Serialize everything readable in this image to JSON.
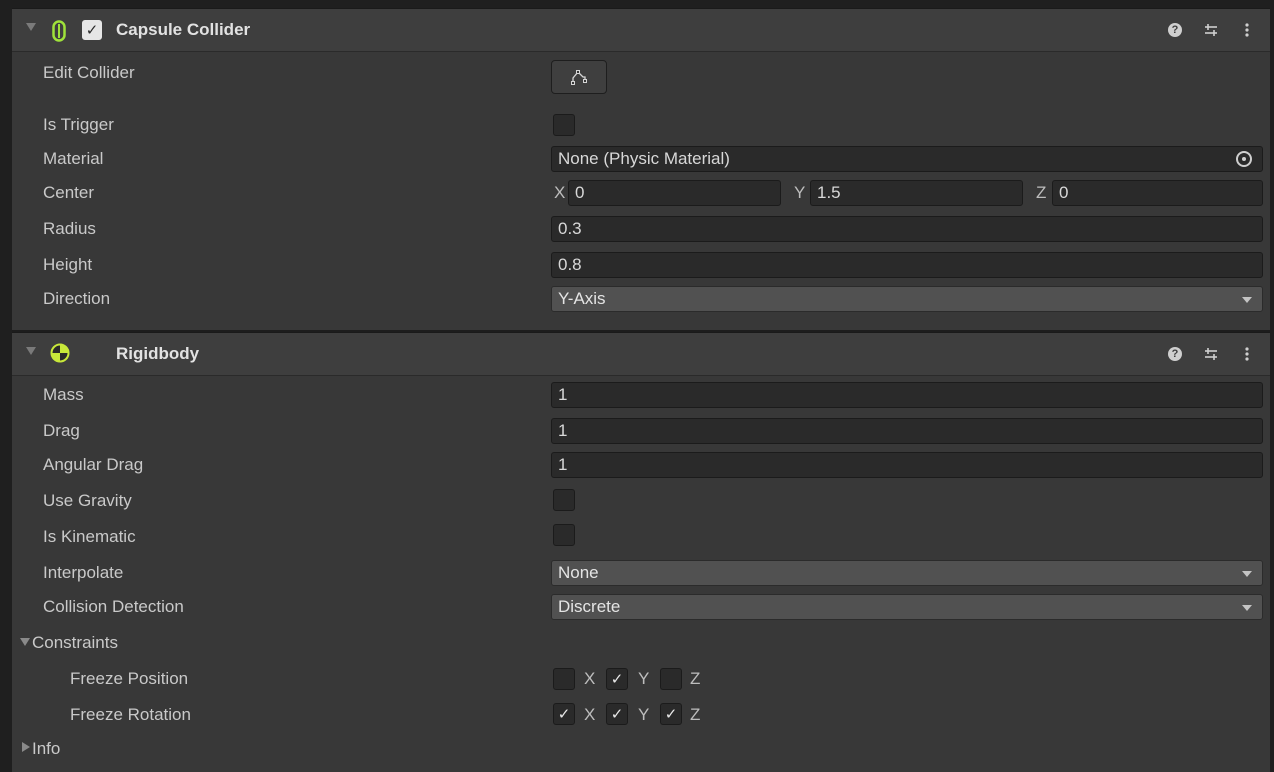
{
  "capsule": {
    "title": "Capsule Collider",
    "enabled_check": "✓",
    "edit_collider_label": "Edit Collider",
    "is_trigger_label": "Is Trigger",
    "material_label": "Material",
    "material_value": "None (Physic Material)",
    "center_label": "Center",
    "center_x_axis": "X",
    "center_x": "0",
    "center_y_axis": "Y",
    "center_y": "1.5",
    "center_z_axis": "Z",
    "center_z": "0",
    "radius_label": "Radius",
    "radius_value": "0.3",
    "height_label": "Height",
    "height_value": "0.8",
    "direction_label": "Direction",
    "direction_value": "Y-Axis"
  },
  "rigidbody": {
    "title": "Rigidbody",
    "mass_label": "Mass",
    "mass_value": "1",
    "drag_label": "Drag",
    "drag_value": "1",
    "angular_drag_label": "Angular Drag",
    "angular_drag_value": "1",
    "use_gravity_label": "Use Gravity",
    "is_kinematic_label": "Is Kinematic",
    "interpolate_label": "Interpolate",
    "interpolate_value": "None",
    "collision_label": "Collision Detection",
    "collision_value": "Discrete",
    "constraints_label": "Constraints",
    "freeze_position_label": "Freeze Position",
    "freeze_rotation_label": "Freeze Rotation",
    "axis_x": "X",
    "axis_y": "Y",
    "axis_z": "Z",
    "check_mark": "✓",
    "info_label": "Info"
  },
  "colors": {
    "capsule_icon": "#9fe23a",
    "rigidbody_icon": "#c8e83a"
  },
  "icons": {
    "help": "help-icon",
    "presets": "presets-icon",
    "more": "kebab-menu-icon"
  }
}
